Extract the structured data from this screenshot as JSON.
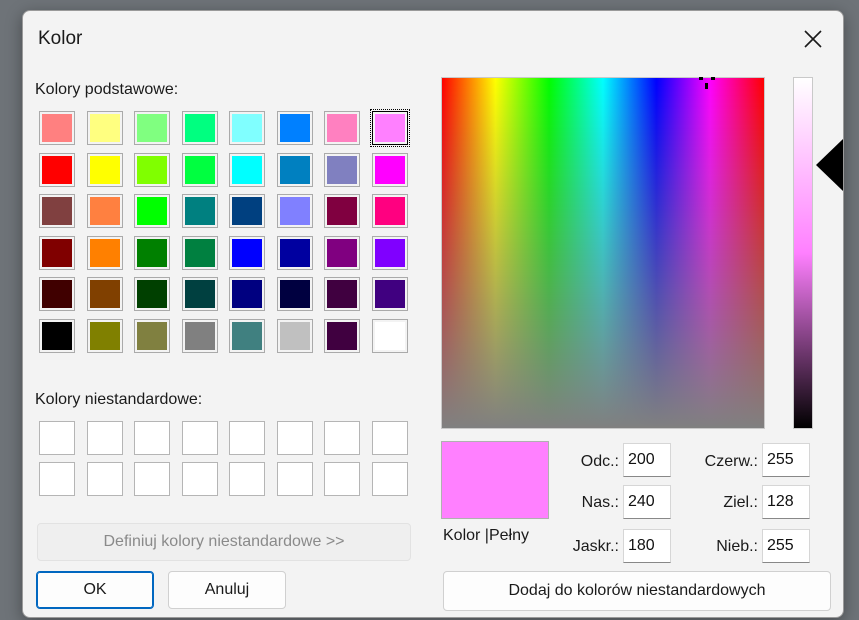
{
  "dialog": {
    "title": "Kolor",
    "close_icon": "close-icon"
  },
  "basic": {
    "label": "Kolory podstawowe:",
    "colors": [
      [
        "#ff8080",
        "#ffff80",
        "#80ff80",
        "#00ff80",
        "#80ffff",
        "#0080ff",
        "#ff80c0",
        "#ff80ff"
      ],
      [
        "#ff0000",
        "#ffff00",
        "#80ff00",
        "#00ff40",
        "#00ffff",
        "#0080c0",
        "#8080c0",
        "#ff00ff"
      ],
      [
        "#804040",
        "#ff8040",
        "#00ff00",
        "#008080",
        "#004080",
        "#8080ff",
        "#800040",
        "#ff0080"
      ],
      [
        "#800000",
        "#ff8000",
        "#008000",
        "#008040",
        "#0000ff",
        "#0000a0",
        "#800080",
        "#8000ff"
      ],
      [
        "#400000",
        "#804000",
        "#004000",
        "#004040",
        "#000080",
        "#000040",
        "#400040",
        "#400080"
      ],
      [
        "#000000",
        "#808000",
        "#808040",
        "#808080",
        "#408080",
        "#c0c0c0",
        "#400040",
        "#ffffff"
      ]
    ]
  },
  "custom": {
    "label": "Kolory niestandardowe:"
  },
  "buttons": {
    "define": "Definiuj kolory niestandardowe >>",
    "ok": "OK",
    "cancel": "Anuluj",
    "add": "Dodaj do kolorów niestandardowych"
  },
  "preview": {
    "color": "#ff80ff",
    "label": "Kolor |Pełny"
  },
  "fields": {
    "hue": {
      "label": "Odc.:",
      "value": "200"
    },
    "sat": {
      "label": "Nas.:",
      "value": "240"
    },
    "lum": {
      "label": "Jaskr.:",
      "value": "180"
    },
    "red": {
      "label": "Czerw.:",
      "value": "255"
    },
    "green": {
      "label": "Ziel.:",
      "value": "128"
    },
    "blue": {
      "label": "Nieb.:",
      "value": "255"
    }
  }
}
